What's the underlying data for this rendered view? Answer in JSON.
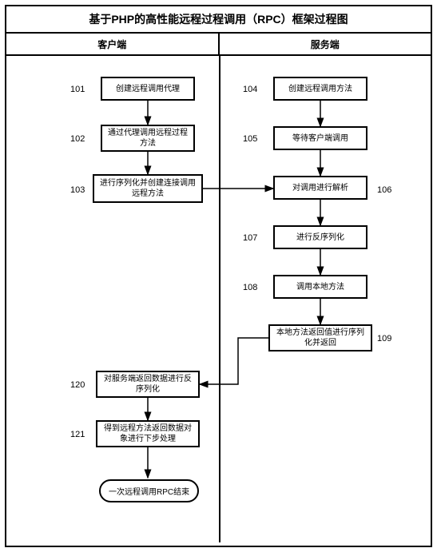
{
  "title": "基于PHP的高性能远程过程调用（RPC）框架过程图",
  "columns": {
    "client": "客户端",
    "server": "服务端"
  },
  "nodes": {
    "n101": {
      "num": "101",
      "text": "创建远程调用代理"
    },
    "n102": {
      "num": "102",
      "text": "通过代理调用远程过程方法"
    },
    "n103": {
      "num": "103",
      "text": "进行序列化并创建连接调用远程方法"
    },
    "n104": {
      "num": "104",
      "text": "创建远程调用方法"
    },
    "n105": {
      "num": "105",
      "text": "等待客户端调用"
    },
    "n106": {
      "num": "106",
      "text": "对调用进行解析"
    },
    "n107": {
      "num": "107",
      "text": "进行反序列化"
    },
    "n108": {
      "num": "108",
      "text": "调用本地方法"
    },
    "n120": {
      "num": "120",
      "text": "对服务端返回数据进行反序列化"
    },
    "n121": {
      "num": "121",
      "text": "得到远程方法返回数据对象进行下步处理"
    },
    "n109": {
      "num": "109",
      "text": "本地方法返回值进行序列化并返回"
    },
    "end": {
      "text": "一次远程调用RPC结束"
    }
  }
}
